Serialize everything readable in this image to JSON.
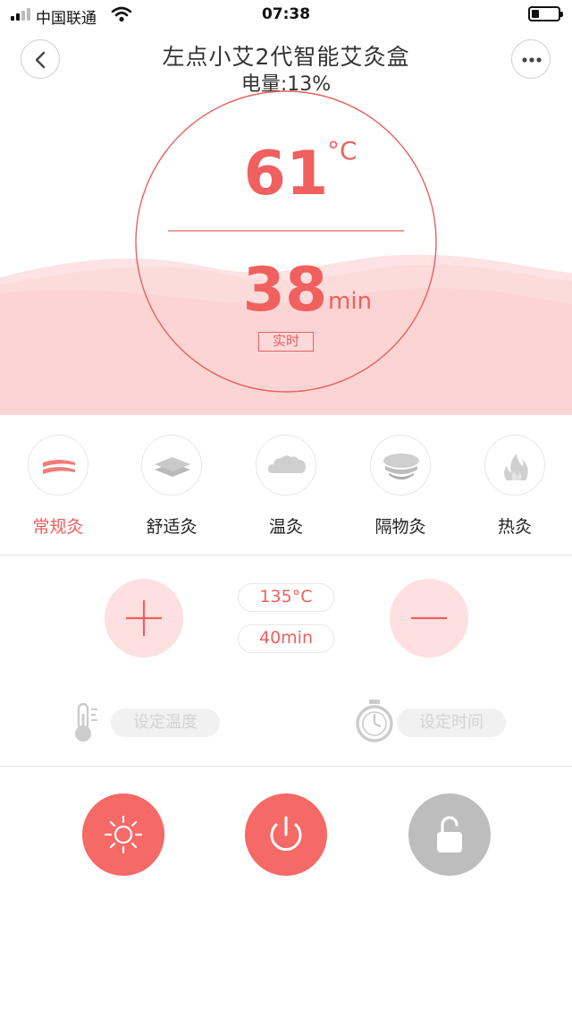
{
  "status_bar": {
    "carrier": "中国联通",
    "time": "07:38",
    "battery_level": 0.3
  },
  "header": {
    "title": "左点小艾2代智能艾灸盒",
    "battery_text": "电量:13%"
  },
  "display": {
    "temperature": "61",
    "temperature_unit": "°C",
    "time": "38",
    "time_unit": "min",
    "realtime_label": "实时"
  },
  "modes": [
    {
      "label": "常规灸",
      "icon": "regular-moxibustion-icon",
      "active": true
    },
    {
      "label": "舒适灸",
      "icon": "comfort-moxibustion-icon",
      "active": false
    },
    {
      "label": "温灸",
      "icon": "warm-moxibustion-icon",
      "active": false
    },
    {
      "label": "隔物灸",
      "icon": "partition-moxibustion-icon",
      "active": false
    },
    {
      "label": "热灸",
      "icon": "hot-moxibustion-icon",
      "active": false
    }
  ],
  "adjust": {
    "set_temperature": "135°C",
    "set_time": "40min",
    "temperature_placeholder": "设定温度",
    "time_placeholder": "设定时间"
  },
  "icons": {
    "back": "back-icon",
    "more": "more-icon",
    "plus": "plus-icon",
    "minus": "minus-icon",
    "thermometer": "thermometer-icon",
    "stopwatch": "stopwatch-icon",
    "heat": "sun-icon",
    "power": "power-icon",
    "lock": "lock-icon"
  },
  "colors": {
    "accent": "#f0605e",
    "accent_light": "#fde0df",
    "wave": "#fcd4d4",
    "inactive": "#bdbdbd"
  }
}
